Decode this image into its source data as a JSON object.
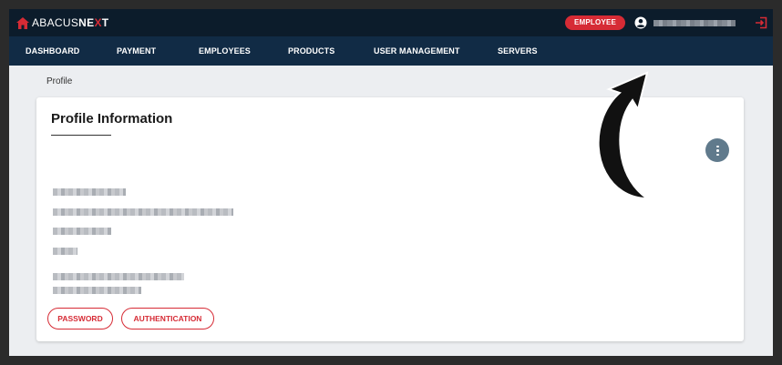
{
  "app": {
    "brand_prefix": "ABACUS",
    "brand_suffix_1": "NE",
    "brand_suffix_x": "X",
    "brand_suffix_2": "T",
    "brand_color": "#d62b35"
  },
  "topbar": {
    "role_badge": "EMPLOYEE",
    "user_icon": "account-circle-icon",
    "logout_icon": "logout-icon"
  },
  "nav": {
    "items": [
      "DASHBOARD",
      "PAYMENT",
      "EMPLOYEES",
      "PRODUCTS",
      "USER MANAGEMENT",
      "SERVERS"
    ]
  },
  "breadcrumb": {
    "current": "Profile"
  },
  "profile": {
    "title": "Profile Information",
    "menu_icon": "more-vertical-icon",
    "buttons": {
      "password": "PASSWORD",
      "authentication": "AUTHENTICATION"
    }
  },
  "colors": {
    "topbar": "#0c1c2b",
    "navbar": "#112b45",
    "accent": "#d62b35",
    "background": "#eceef1",
    "menu_button": "#607a8c"
  }
}
